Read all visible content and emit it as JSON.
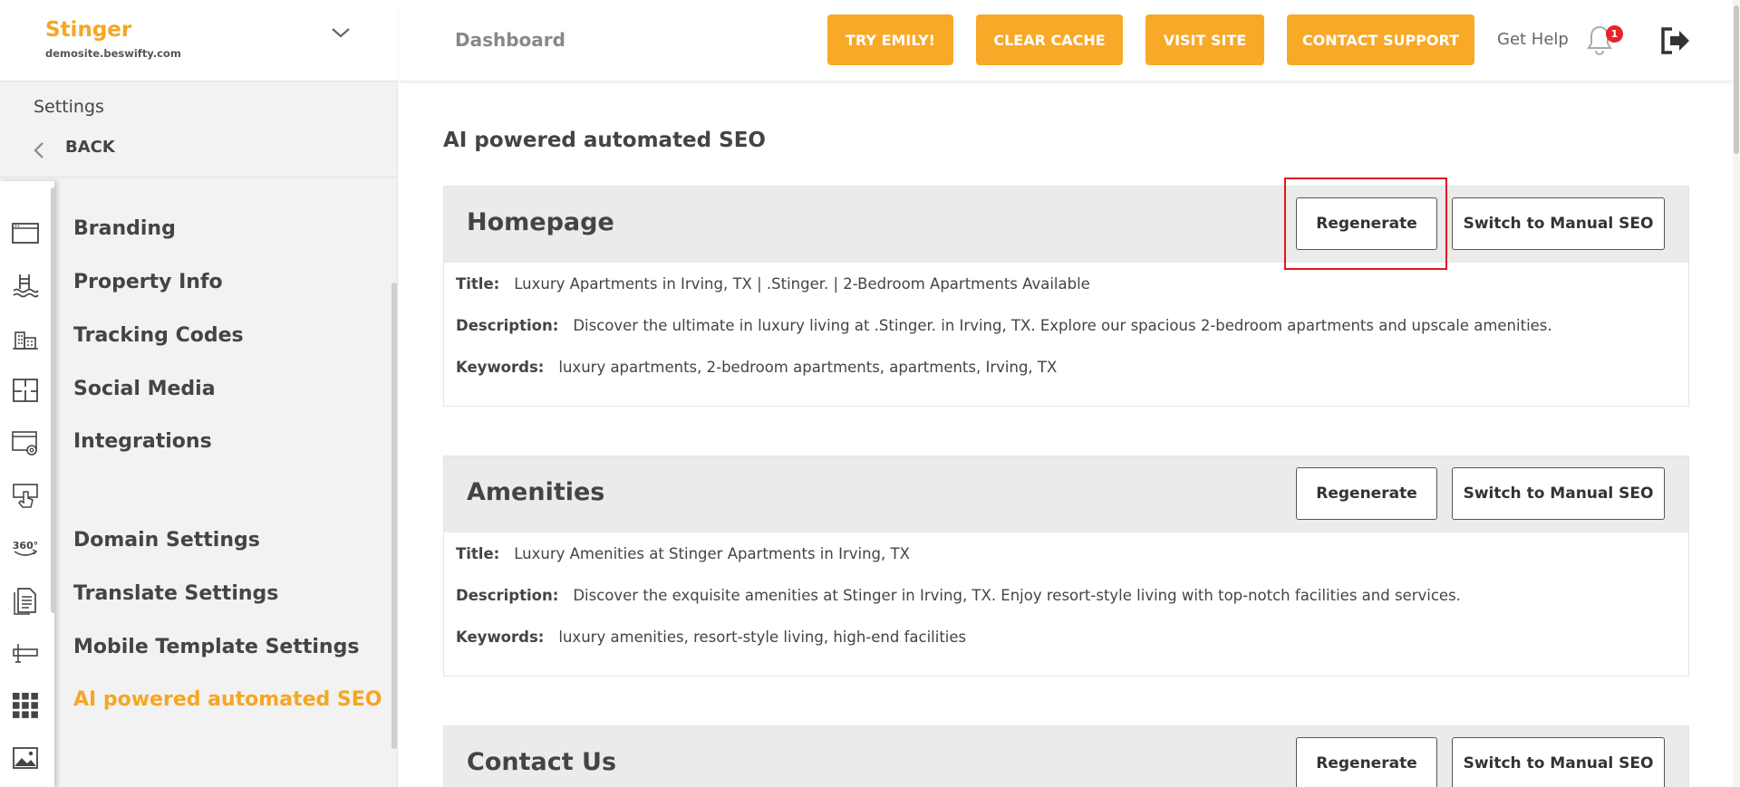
{
  "brand": {
    "name": "Stinger",
    "domain": "demosite.beswifty.com"
  },
  "sidebar": {
    "settings_label": "Settings",
    "back_label": "BACK",
    "icons": [
      "browser-window-icon",
      "pool-icon",
      "buildings-icon",
      "floorplan-icon",
      "web-settings-icon",
      "touch-panel-icon",
      "360-view-icon",
      "document-icon",
      "sign-icon",
      "grid-icon",
      "image-icon"
    ],
    "items": [
      {
        "label": "Branding"
      },
      {
        "label": "Property Info"
      },
      {
        "label": "Tracking Codes"
      },
      {
        "label": "Social Media"
      },
      {
        "label": "Integrations"
      },
      {
        "label": "Domain Settings"
      },
      {
        "label": "Translate Settings"
      },
      {
        "label": "Mobile Template Settings"
      },
      {
        "label": "AI powered automated SEO",
        "active": true
      }
    ]
  },
  "header": {
    "title": "Dashboard",
    "buttons": [
      "TRY EMILY!",
      "CLEAR CACHE",
      "VISIT SITE",
      "CONTACT SUPPORT"
    ],
    "get_help": "Get Help",
    "notification_count": "1"
  },
  "main": {
    "title": "AI powered automated SEO",
    "regenerate_label": "Regenerate",
    "manual_label": "Switch to Manual SEO",
    "field_labels": {
      "title": "Title:",
      "description": "Description:",
      "keywords": "Keywords:"
    },
    "cards": [
      {
        "name": "Homepage",
        "title": "Luxury Apartments in Irving, TX | .Stinger. | 2-Bedroom Apartments Available",
        "description": "Discover the ultimate in luxury living at .Stinger. in Irving, TX. Explore our spacious 2-bedroom apartments and upscale amenities.",
        "keywords": "luxury apartments, 2-bedroom apartments, apartments, Irving, TX"
      },
      {
        "name": "Amenities",
        "title": "Luxury Amenities at Stinger Apartments in Irving, TX",
        "description": "Discover the exquisite amenities at Stinger in Irving, TX. Enjoy resort-style living with top-notch facilities and services.",
        "keywords": "luxury amenities, resort-style living, high-end facilities"
      },
      {
        "name": "Contact Us"
      }
    ]
  },
  "colors": {
    "accent": "#f8a928",
    "brand": "#f5a623",
    "badge": "#e8232a",
    "highlight": "#e0181f"
  }
}
